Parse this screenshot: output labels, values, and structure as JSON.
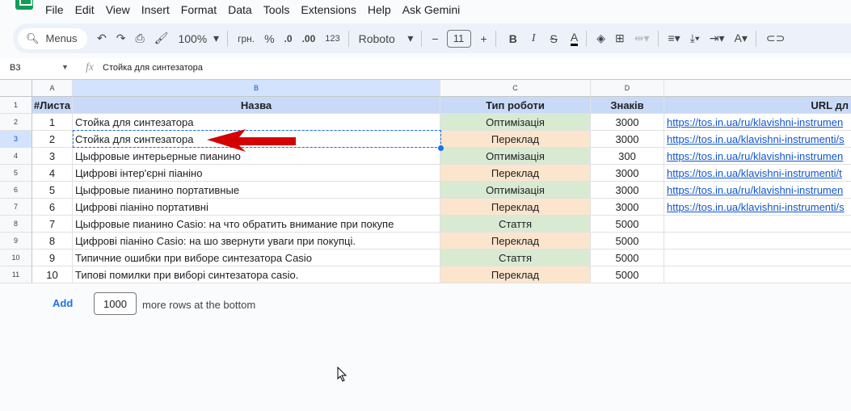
{
  "menu": [
    "File",
    "Edit",
    "View",
    "Insert",
    "Format",
    "Data",
    "Tools",
    "Extensions",
    "Help",
    "Ask Gemini"
  ],
  "toolbar": {
    "search": "Menus",
    "zoom": "100%",
    "currency": "грн.",
    "percent": "%",
    "dec_decrease": ".0",
    "dec_increase": ".00",
    "format_123": "123",
    "font": "Roboto",
    "font_size": "11"
  },
  "formula": {
    "cell": "B3",
    "value": "Стойка для синтезатора"
  },
  "columns": [
    "A",
    "B",
    "C",
    "D"
  ],
  "headers": [
    "#Листа",
    "Назва",
    "Тип роботи",
    "Знаків",
    "URL дл"
  ],
  "rows": [
    {
      "n": "1",
      "name": "Стойка для синтезатора",
      "type": "Оптимізація",
      "chars": "3000",
      "url": "https://tos.in.ua/ru/klavishni-instrumen"
    },
    {
      "n": "2",
      "name": "Стойка для синтезатора",
      "type": "Переклад",
      "chars": "3000",
      "url": "https://tos.in.ua/klavishni-instrumenti/s"
    },
    {
      "n": "3",
      "name": "Цыфровые интерьерные пианино",
      "type": "Оптимізація",
      "chars": "300",
      "url": "https://tos.in.ua/ru/klavishni-instrumen"
    },
    {
      "n": "4",
      "name": "Цифрові інтер'єрні піаніно",
      "type": "Переклад",
      "chars": "3000",
      "url": "https://tos.in.ua/klavishni-instrumenti/t"
    },
    {
      "n": "5",
      "name": "Цыфровые пианино портативные",
      "type": "Оптимізація",
      "chars": "3000",
      "url": "https://tos.in.ua/ru/klavishni-instrumen"
    },
    {
      "n": "6",
      "name": "Цифрові піаніно портативні",
      "type": "Переклад",
      "chars": "3000",
      "url": "https://tos.in.ua/klavishni-instrumenti/s"
    },
    {
      "n": "7",
      "name": "Цыфровые пианино Casio: на что обратить внимание при покупе",
      "type": "Стаття",
      "chars": "5000",
      "url": ""
    },
    {
      "n": "8",
      "name": "Цифрові піаніно Casio: на шо звернути уваги при покупці.",
      "type": "Переклад",
      "chars": "5000",
      "url": ""
    },
    {
      "n": "9",
      "name": "Типичние ошибки при виборе синтезатора Casio",
      "type": "Стаття",
      "chars": "5000",
      "url": ""
    },
    {
      "n": "10",
      "name": "Типові помилки при виборі синтезатора casio.",
      "type": "Переклад",
      "chars": "5000",
      "url": ""
    }
  ],
  "add_rows": {
    "button": "Add",
    "count": "1000",
    "suffix": "more rows at the bottom"
  },
  "colors": {
    "green": "#d9ead3",
    "orange": "#fce5cd",
    "header": "#c9daf8",
    "arrow": "#d50000"
  }
}
